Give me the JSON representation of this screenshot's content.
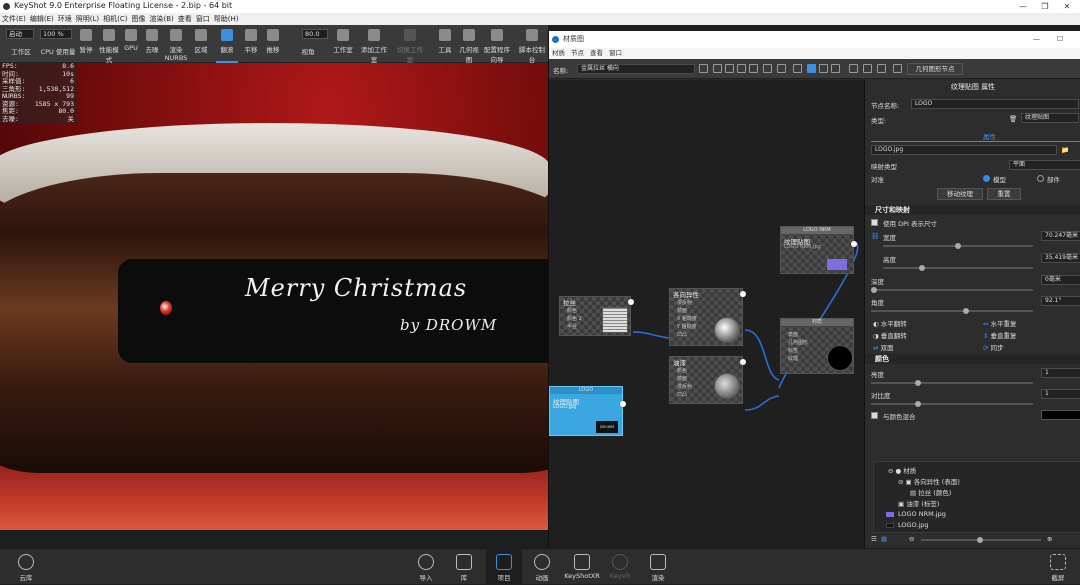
{
  "app": {
    "title": "KeyShot 9.0 Enterprise Floating License  - 2.bip  - 64 bit",
    "menu": [
      "文件(E)",
      "编辑(E)",
      "环境",
      "照明(L)",
      "相机(C)",
      "图像",
      "渲染(B)",
      "查看",
      "窗口",
      "帮助(H)"
    ]
  },
  "toolbar": {
    "mode_value": "启动",
    "zoom_value": "100 %",
    "fov_value": "80.0",
    "items": [
      {
        "label": "工作区",
        "icon": "workspace-icon",
        "state": "normal"
      },
      {
        "label": "CPU 使用量",
        "icon": "cpu-icon",
        "state": "normal"
      },
      {
        "label": "暂停",
        "icon": "pause-icon",
        "state": "normal"
      },
      {
        "label": "性能模式",
        "icon": "performance-icon",
        "state": "normal"
      },
      {
        "label": "GPU",
        "icon": "gpu-icon",
        "state": "normal"
      },
      {
        "label": "去噪",
        "icon": "denoise-icon",
        "state": "normal"
      },
      {
        "label": "渲染 NURBS",
        "icon": "nurbs-icon",
        "state": "normal"
      },
      {
        "label": "区域",
        "icon": "region-icon",
        "state": "normal"
      },
      {
        "label": "翻滚",
        "icon": "tumble-icon",
        "state": "active"
      },
      {
        "label": "平移",
        "icon": "pan-icon",
        "state": "normal"
      },
      {
        "label": "推移",
        "icon": "dolly-icon",
        "state": "normal"
      },
      {
        "label": "视角",
        "icon": "perspective-icon",
        "state": "normal"
      },
      {
        "label": "工作室",
        "icon": "studio-icon",
        "state": "normal"
      },
      {
        "label": "添加工作室",
        "icon": "add-studio-icon",
        "state": "normal"
      },
      {
        "label": "切换工作室",
        "icon": "switch-studio-icon",
        "state": "dim"
      },
      {
        "label": "工具",
        "icon": "tools-icon",
        "state": "normal"
      },
      {
        "label": "几何视图",
        "icon": "geometry-view-icon",
        "state": "normal"
      },
      {
        "label": "配置程序向导",
        "icon": "configurator-icon",
        "state": "normal"
      },
      {
        "label": "脚本控制台",
        "icon": "script-console-icon",
        "state": "normal"
      }
    ]
  },
  "stats": [
    {
      "k": "FPS:",
      "v": "8.6"
    },
    {
      "k": "时间:",
      "v": "10s"
    },
    {
      "k": "采样值:",
      "v": "6"
    },
    {
      "k": "三角形:",
      "v": "1,538,512"
    },
    {
      "k": "NURBS:",
      "v": "99"
    },
    {
      "k": "资源:",
      "v": "1585 x 793"
    },
    {
      "k": "焦距:",
      "v": "80.0"
    },
    {
      "k": "去噪:",
      "v": "关"
    }
  ],
  "scene": {
    "line1": "Merry  Christmas",
    "line2": "by DROWM"
  },
  "bottombar": [
    {
      "label": "云库",
      "icon": "cloud-library-icon",
      "state": "normal"
    },
    {
      "label": "导入",
      "icon": "import-icon",
      "state": "normal"
    },
    {
      "label": "库",
      "icon": "library-icon",
      "state": "normal"
    },
    {
      "label": "项目",
      "icon": "project-icon",
      "state": "active"
    },
    {
      "label": "动画",
      "icon": "animation-icon",
      "state": "normal"
    },
    {
      "label": "KeyShotXR",
      "icon": "keyshotxr-icon",
      "state": "normal"
    },
    {
      "label": "KeyVR",
      "icon": "keyvr-icon",
      "state": "dim"
    },
    {
      "label": "渲染",
      "icon": "render-icon",
      "state": "normal"
    },
    {
      "label": "截屏",
      "icon": "screenshot-icon",
      "state": "normal"
    }
  ],
  "material_window": {
    "title": "材质图",
    "menu": [
      "材质",
      "节点",
      "查看",
      "窗口"
    ],
    "name_label": "名称:",
    "name_value": "金属拉丝 横向",
    "geometry_button": "几何图形节点",
    "nodes": {
      "label_tex": {
        "header": "LOGO NRM",
        "name": "纹理贴图",
        "sub": "LOGO NRM.jpg"
      },
      "brushed": {
        "header": "",
        "name": "拉丝",
        "ports": [
          "颜色",
          "颜色 2",
          "半径"
        ]
      },
      "aniso": {
        "header": "",
        "name": "各向异性",
        "ports": [
          "漫反射",
          "镜面",
          "X 粗糙度",
          "Y 粗糙度",
          "凹凸"
        ]
      },
      "material": {
        "header": "材质",
        "name": "材质",
        "ports": [
          "表面",
          "几何图形",
          "标签",
          "纹理"
        ]
      },
      "paint": {
        "header": "",
        "name": "油漆",
        "ports": [
          "颜色",
          "镜面",
          "漫反射",
          "凹凸"
        ]
      },
      "logo_tex": {
        "header": "LOGO",
        "name": "纹理贴图",
        "sub": "LOGO.jpg",
        "thumb_text": "DROWM"
      }
    },
    "props": {
      "header_title": "纹理贴图 属性",
      "node_name_label": "节点名称:",
      "node_name_value": "LOGO",
      "type_label": "类型:",
      "type_value": "纹理贴图",
      "tab_label": "属性",
      "file_value": "LOGO.jpg",
      "mapping_label": "映射类型",
      "mapping_value": "平面",
      "align_label": "对准",
      "align_model": "模型",
      "align_part": "部件",
      "move_texture_btn": "移动纹理",
      "reset_btn": "重置",
      "size_section": "尺寸和映射",
      "dpi_label": "使用 DPI 表示尺寸",
      "width_label": "宽度",
      "width_value": "70.247毫米",
      "height_label": "高度",
      "height_value": "35.419毫米",
      "depth_label": "深度",
      "depth_value": "0毫米",
      "angle_label": "角度",
      "angle_value": "92.1°",
      "flip_h": "水平翻转",
      "repeat_h": "水平重复",
      "flip_v": "垂直翻转",
      "repeat_v": "垂直重复",
      "both_sides": "双面",
      "sync": "同步",
      "color_section": "颜色",
      "brightness_label": "亮度",
      "brightness_value": "1",
      "contrast_label": "对比度",
      "contrast_value": "1",
      "mix_color_label": "与颜色混合",
      "tree": [
        {
          "label": "材质",
          "level": 0
        },
        {
          "label": "各向异性 (表面)",
          "level": 1
        },
        {
          "label": "拉丝 (颜色)",
          "level": 2
        },
        {
          "label": "油漆 (标签)",
          "level": 1
        },
        {
          "label": "LOGO NRM.jpg",
          "level": 0,
          "swatch": "#7b6fe0"
        },
        {
          "label": "LOGO.jpg",
          "level": 0,
          "swatch": "#1a1a1a"
        }
      ]
    }
  },
  "colors": {
    "accent": "#3d8fe0",
    "selected_node": "#3ba7e0",
    "link": "#2a6fd6",
    "scene_red": "#b01818"
  }
}
